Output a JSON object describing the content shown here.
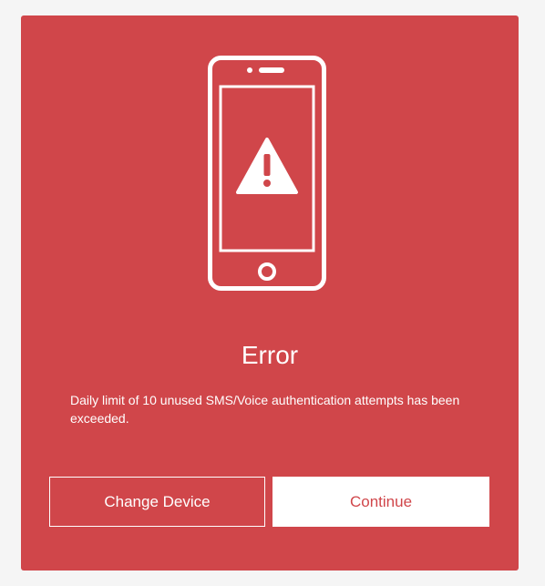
{
  "dialog": {
    "icon": "phone-warning-icon",
    "title": "Error",
    "message": "Daily limit of 10 unused SMS/Voice authentication attempts has been exceeded.",
    "buttons": {
      "change_device": "Change Device",
      "continue": "Continue"
    }
  },
  "colors": {
    "background": "#f5f5f5",
    "card": "#d0464a",
    "text": "#ffffff"
  }
}
